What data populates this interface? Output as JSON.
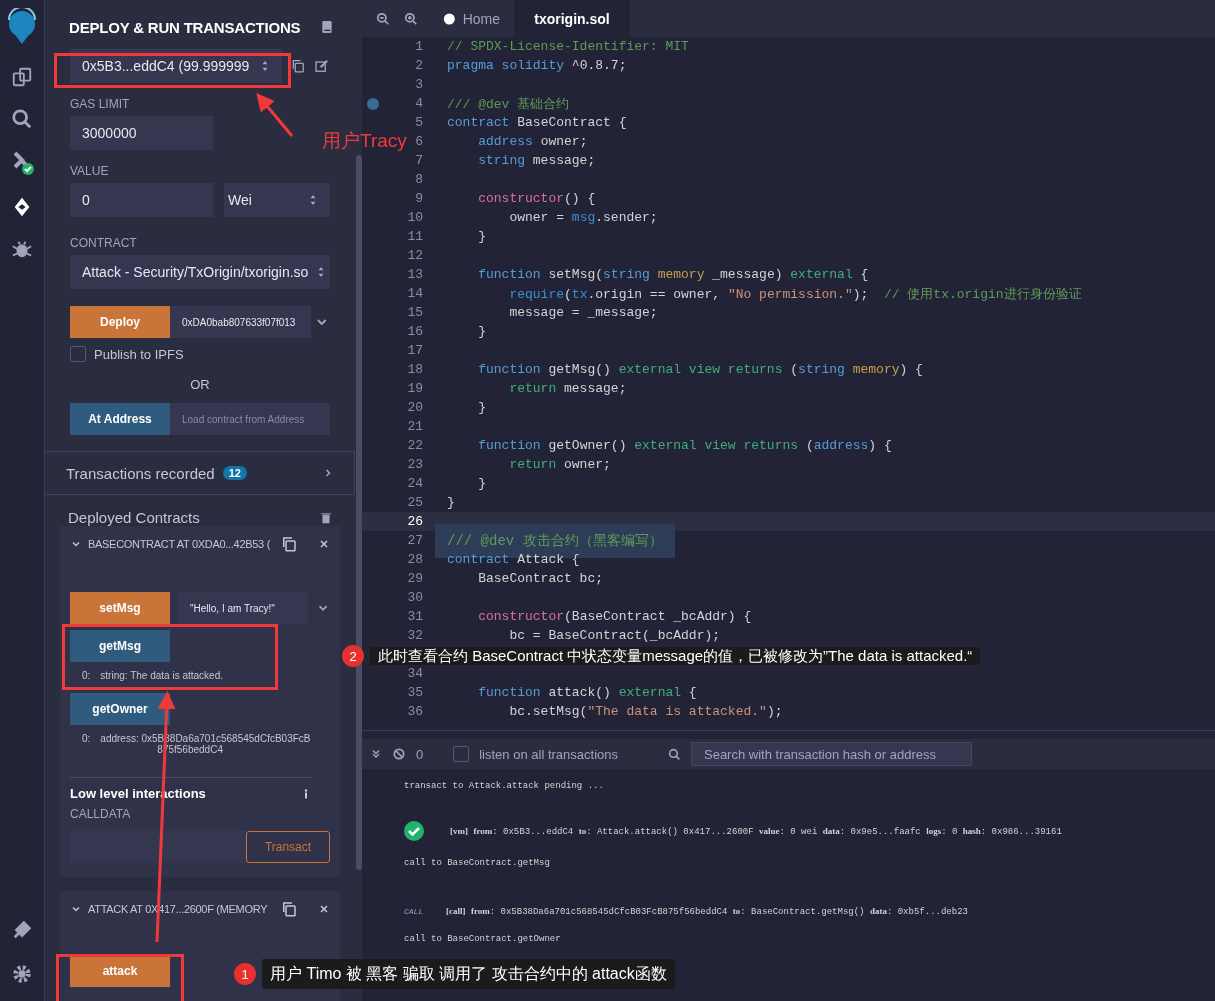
{
  "panel": {
    "title": "DEPLOY & RUN TRANSACTIONS",
    "account": "0x5B3...eddC4 (99.999999",
    "gas_limit": {
      "label": "GAS LIMIT",
      "value": "3000000"
    },
    "value": {
      "label": "VALUE",
      "value": "0",
      "unit": "Wei"
    },
    "contract": {
      "label": "CONTRACT",
      "value": "Attack - Security/TxOrigin/txorigin.so"
    },
    "deploy": {
      "label": "Deploy",
      "arg": "0xDA0bab807633f07f013"
    },
    "publish": {
      "label": "Publish to IPFS",
      "checked": false
    },
    "or": "OR",
    "at_address": {
      "label": "At Address",
      "placeholder": "Load contract from Address"
    },
    "transactions_recorded": {
      "label": "Transactions recorded",
      "count": "12"
    },
    "deployed_title": "Deployed Contracts",
    "instances": [
      {
        "title": "BASECONTRACT AT 0XDA0...42B53 (",
        "functions": [
          {
            "kind": "transact",
            "label": "setMsg",
            "arg": "\"Hello, I am Tracy!\""
          },
          {
            "kind": "call",
            "label": "getMsg",
            "output_index": "0:",
            "output": "string: The data is attacked."
          },
          {
            "kind": "call",
            "label": "getOwner",
            "output_index": "0:",
            "output": "address: 0x5B38Da6a701c568545dCfcB03FcB875f56beddC4"
          }
        ],
        "low_level": {
          "title": "Low level interactions",
          "calldata": "CALLDATA",
          "button": "Transact"
        }
      },
      {
        "title": "ATTACK AT 0X417...2600F (MEMORY",
        "functions": [
          {
            "kind": "transact",
            "label": "attack"
          }
        ]
      }
    ]
  },
  "editor": {
    "tabs": [
      {
        "label": "Home",
        "selected": false
      },
      {
        "label": "txorigin.sol",
        "selected": true
      }
    ],
    "lines": [
      {
        "n": "1",
        "active": false,
        "selected": false,
        "breakpoint": false,
        "tokens": [
          {
            "kind": "comment",
            "text": "// SPDX-License-Identifier: MIT"
          }
        ]
      },
      {
        "n": "2",
        "active": false,
        "selected": false,
        "breakpoint": false,
        "tokens": [
          {
            "kind": "keyword",
            "text": "pragma"
          },
          {
            "kind": "keyword",
            "text": " solidity"
          },
          {
            "kind": "plain",
            "text": " ^0.8.7;"
          }
        ]
      },
      {
        "n": "3",
        "active": false,
        "selected": false,
        "breakpoint": false
      },
      {
        "n": "4",
        "active": false,
        "selected": false,
        "breakpoint": true,
        "tokens": [
          {
            "kind": "comment",
            "text": "/// @dev 基础合约"
          }
        ]
      },
      {
        "n": "5",
        "active": false,
        "selected": false,
        "breakpoint": false,
        "tokens": [
          {
            "kind": "keyword",
            "text": "contract"
          },
          {
            "kind": "plain",
            "text": " BaseContract {"
          }
        ]
      },
      {
        "n": "6",
        "active": false,
        "selected": false,
        "breakpoint": false,
        "tokens": [
          {
            "kind": "keyword",
            "text": "    address"
          },
          {
            "kind": "plain",
            "text": " owner;"
          }
        ]
      },
      {
        "n": "7",
        "active": false,
        "selected": false,
        "breakpoint": false,
        "tokens": [
          {
            "kind": "keyword",
            "text": "    string"
          },
          {
            "kind": "plain",
            "text": " message;"
          }
        ]
      },
      {
        "n": "8",
        "active": false,
        "selected": false,
        "breakpoint": false
      },
      {
        "n": "9",
        "active": false,
        "selected": false,
        "breakpoint": false,
        "tokens": [
          {
            "kind": "fn",
            "text": "    constructor"
          },
          {
            "kind": "plain",
            "text": "() {"
          }
        ]
      },
      {
        "n": "10",
        "active": false,
        "selected": false,
        "breakpoint": false,
        "tokens": [
          {
            "kind": "plain",
            "text": "        owner = "
          },
          {
            "kind": "builtin",
            "text": "msg"
          },
          {
            "kind": "plain",
            "text": ".sender;"
          }
        ]
      },
      {
        "n": "11",
        "active": false,
        "selected": false,
        "breakpoint": false,
        "tokens": [
          {
            "kind": "plain",
            "text": "    }"
          }
        ]
      },
      {
        "n": "12",
        "active": false,
        "selected": false,
        "breakpoint": false
      },
      {
        "n": "13",
        "active": false,
        "selected": false,
        "breakpoint": false,
        "tokens": [
          {
            "kind": "keyword",
            "text": "    function"
          },
          {
            "kind": "plain",
            "text": " setMsg("
          },
          {
            "kind": "keyword",
            "text": "string"
          },
          {
            "kind": "modifier",
            "text": " memory"
          },
          {
            "kind": "plain",
            "text": " _message) "
          },
          {
            "kind": "green",
            "text": "external"
          },
          {
            "kind": "plain",
            "text": " {"
          }
        ]
      },
      {
        "n": "14",
        "active": false,
        "selected": false,
        "breakpoint": false,
        "tokens": [
          {
            "kind": "builtin",
            "text": "        require"
          },
          {
            "kind": "plain",
            "text": "("
          },
          {
            "kind": "builtin",
            "text": "tx"
          },
          {
            "kind": "plain",
            "text": ".origin == owner, "
          },
          {
            "kind": "string",
            "text": "\"No permission.\""
          },
          {
            "kind": "plain",
            "text": ");"
          },
          {
            "kind": "comment",
            "text": "  // 使用tx.origin进行身份验证"
          }
        ]
      },
      {
        "n": "15",
        "active": false,
        "selected": false,
        "breakpoint": false,
        "tokens": [
          {
            "kind": "plain",
            "text": "        message = _message;"
          }
        ]
      },
      {
        "n": "16",
        "active": false,
        "selected": false,
        "breakpoint": false,
        "tokens": [
          {
            "kind": "plain",
            "text": "    }"
          }
        ]
      },
      {
        "n": "17",
        "active": false,
        "selected": false,
        "breakpoint": false
      },
      {
        "n": "18",
        "active": false,
        "selected": false,
        "breakpoint": false,
        "tokens": [
          {
            "kind": "keyword",
            "text": "    function"
          },
          {
            "kind": "plain",
            "text": " getMsg() "
          },
          {
            "kind": "green",
            "text": "external view returns"
          },
          {
            "kind": "plain",
            "text": " ("
          },
          {
            "kind": "keyword",
            "text": "string"
          },
          {
            "kind": "modifier",
            "text": " memory"
          },
          {
            "kind": "plain",
            "text": ") {"
          }
        ]
      },
      {
        "n": "19",
        "active": false,
        "selected": false,
        "breakpoint": false,
        "tokens": [
          {
            "kind": "green",
            "text": "        return"
          },
          {
            "kind": "plain",
            "text": " message;"
          }
        ]
      },
      {
        "n": "20",
        "active": false,
        "selected": false,
        "breakpoint": false,
        "tokens": [
          {
            "kind": "plain",
            "text": "    }"
          }
        ]
      },
      {
        "n": "21",
        "active": false,
        "selected": false,
        "breakpoint": false
      },
      {
        "n": "22",
        "active": false,
        "selected": false,
        "breakpoint": false,
        "tokens": [
          {
            "kind": "keyword",
            "text": "    function"
          },
          {
            "kind": "plain",
            "text": " getOwner() "
          },
          {
            "kind": "green",
            "text": "external view returns"
          },
          {
            "kind": "plain",
            "text": " ("
          },
          {
            "kind": "keyword",
            "text": "address"
          },
          {
            "kind": "plain",
            "text": ") {"
          }
        ]
      },
      {
        "n": "23",
        "active": false,
        "selected": false,
        "breakpoint": false,
        "tokens": [
          {
            "kind": "green",
            "text": "        return"
          },
          {
            "kind": "plain",
            "text": " owner;"
          }
        ]
      },
      {
        "n": "24",
        "active": false,
        "selected": false,
        "breakpoint": false,
        "tokens": [
          {
            "kind": "plain",
            "text": "    }"
          }
        ]
      },
      {
        "n": "25",
        "active": false,
        "selected": false,
        "breakpoint": false,
        "tokens": [
          {
            "kind": "plain",
            "text": "}"
          }
        ]
      },
      {
        "n": "26",
        "active": true,
        "selected": false,
        "breakpoint": false
      },
      {
        "n": "27",
        "active": false,
        "selected": true,
        "breakpoint": false,
        "tokens": [
          {
            "kind": "comment",
            "text": "/// @dev 攻击合约（黑客编写）"
          }
        ]
      },
      {
        "n": "28",
        "active": false,
        "selected": false,
        "breakpoint": false,
        "tokens": [
          {
            "kind": "keyword",
            "text": "contract"
          },
          {
            "kind": "plain",
            "text": " Attack {"
          }
        ]
      },
      {
        "n": "29",
        "active": false,
        "selected": false,
        "breakpoint": false,
        "tokens": [
          {
            "kind": "plain",
            "text": "    BaseContract bc;"
          }
        ]
      },
      {
        "n": "30",
        "active": false,
        "selected": false,
        "breakpoint": false
      },
      {
        "n": "31",
        "active": false,
        "selected": false,
        "breakpoint": false,
        "tokens": [
          {
            "kind": "fn",
            "text": "    constructor"
          },
          {
            "kind": "plain",
            "text": "(BaseContract _bcAddr) {"
          }
        ]
      },
      {
        "n": "32",
        "active": false,
        "selected": false,
        "breakpoint": false,
        "tokens": [
          {
            "kind": "plain",
            "text": "        bc = BaseContract(_bcAddr);"
          }
        ]
      },
      {
        "active": false,
        "selected": false,
        "breakpoint": false
      },
      {
        "n": "34",
        "active": false,
        "selected": false,
        "breakpoint": false
      },
      {
        "n": "35",
        "active": false,
        "selected": false,
        "breakpoint": false,
        "tokens": [
          {
            "kind": "keyword",
            "text": "    function"
          },
          {
            "kind": "plain",
            "text": " attack() "
          },
          {
            "kind": "green",
            "text": "external"
          },
          {
            "kind": "plain",
            "text": " {"
          }
        ]
      },
      {
        "n": "36",
        "active": false,
        "selected": false,
        "breakpoint": false,
        "tokens": [
          {
            "kind": "plain",
            "text": "        bc.setMsg("
          },
          {
            "kind": "string",
            "text": "\"The data is attacked.\""
          },
          {
            "kind": "plain",
            "text": ");"
          }
        ]
      }
    ]
  },
  "terminal": {
    "count": "0",
    "listen": {
      "label": "listen on all transactions",
      "checked": false
    },
    "search_placeholder": "Search with transaction hash or address",
    "logs": [
      {
        "kind": "info",
        "text": "transact to Attack.attack pending ..."
      },
      {
        "kind": "tx",
        "text": "**[vm]** **from**: 0x5B3...eddC4 **to**: Attack.attack() 0x417...2600F **value**: 0 wei **data**: 0x9e5...faafc **logs**: 0 **hash**: 0x986...39161"
      },
      {
        "kind": "info",
        "text": "call to BaseContract.getMsg"
      },
      {
        "kind": "call",
        "badge": "CALL",
        "text": "**[call]** **from**: 0x5B38Da6a701c568545dCfcB03FcB875f56beddC4 **to**: BaseContract.getMsg() **data**: 0xb5f...deb23"
      },
      {
        "kind": "info",
        "text": "call to BaseContract.getOwner"
      }
    ]
  },
  "annotations": {
    "label": "用户Tracy",
    "callouts": [
      {
        "number": "2",
        "text": "此时查看合约 BaseContract 中状态变量message的值，已被修改为”The data is attacked.“"
      },
      {
        "number": "1",
        "text": "用户 Timo 被 黑客 骗取 调用了 攻击合约中的 attack函数"
      }
    ]
  }
}
